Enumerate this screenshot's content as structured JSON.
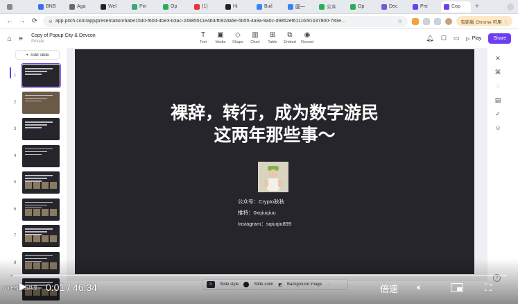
{
  "browser": {
    "tabs": [
      {
        "label": "",
        "icon": "tab-icon",
        "color": "#888888"
      },
      {
        "label": "BNB",
        "icon": "bnb-icon",
        "color": "#3a6df0"
      },
      {
        "label": "Aga",
        "icon": "aga-icon",
        "color": "#6a6a6a"
      },
      {
        "label": "Wel",
        "icon": "github-icon",
        "color": "#222222"
      },
      {
        "label": "Pin",
        "icon": "pin-icon",
        "color": "#3aa876"
      },
      {
        "label": "Op",
        "icon": "op-icon",
        "color": "#2cae52"
      },
      {
        "label": "(1)",
        "icon": "youtube-icon",
        "color": "#e33"
      },
      {
        "label": "Hi",
        "icon": "hi-icon",
        "color": "#222"
      },
      {
        "label": "Buil",
        "icon": "build-icon",
        "color": "#3b82f6"
      },
      {
        "label": "國一",
        "icon": "doc-icon",
        "color": "#3b82f6"
      },
      {
        "label": "公众",
        "icon": "wechat-icon",
        "color": "#2cae52"
      },
      {
        "label": "Op",
        "icon": "op-icon",
        "color": "#2cae52"
      },
      {
        "label": "Dec",
        "icon": "dec-icon",
        "color": "#6b5bd6"
      },
      {
        "label": "Pre",
        "icon": "pitch-icon",
        "color": "#6c3df2"
      },
      {
        "label": "Cop",
        "icon": "pitch-icon",
        "color": "#6c3df2",
        "active": true
      }
    ],
    "url": "app.pitch.com/app/presentation/6abe1540-f60d-4be3-b3ac-24985511e4b3/fb92da6e-5b55-4a9a-9a0c-d9852ef61116/91b37800-783e...",
    "profile_label": "有新版 Chrome 可用"
  },
  "app": {
    "doc_title": "Copy of Popup City & Devcon",
    "doc_visibility": "Private",
    "tools": [
      "Text",
      "Media",
      "Shape",
      "Chart",
      "Table",
      "Embed",
      "Record"
    ],
    "play_label": "Play",
    "share_label": "Share",
    "add_slide_label": "Add slide",
    "slide_numbers": [
      "1",
      "2",
      "3",
      "4",
      "5",
      "6",
      "7",
      "8",
      "9"
    ]
  },
  "slide": {
    "title_line1": "裸辞，转行，成为数字游民",
    "title_line2": "这两年那些事～",
    "info_lines": [
      "公众号：Crypto秋秋",
      "推特：0xqiuqiuu",
      "Instagram：sqiuqiu899"
    ]
  },
  "slide_bar": {
    "style_label": "Slide style",
    "color_label": "Slide color",
    "bg_label": "Background image",
    "more_label": "..."
  },
  "video": {
    "current_time": "0:01",
    "separator": "/",
    "duration": "46:34",
    "speed_label": "倍速",
    "watermark": "onoe的主页共享",
    "progress": 0.0004
  }
}
